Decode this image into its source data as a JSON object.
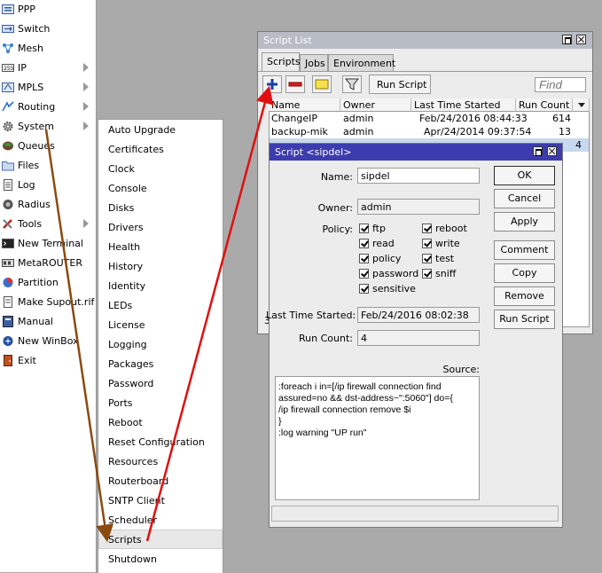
{
  "left_menu": {
    "items": [
      {
        "label": "PPP",
        "icon": "ppp-icon",
        "submenu": false
      },
      {
        "label": "Switch",
        "icon": "switch-icon",
        "submenu": false
      },
      {
        "label": "Mesh",
        "icon": "mesh-icon",
        "submenu": false
      },
      {
        "label": "IP",
        "icon": "ip-icon",
        "submenu": true
      },
      {
        "label": "MPLS",
        "icon": "mpls-icon",
        "submenu": true
      },
      {
        "label": "Routing",
        "icon": "routing-icon",
        "submenu": true
      },
      {
        "label": "System",
        "icon": "gear-icon",
        "submenu": true
      },
      {
        "label": "Queues",
        "icon": "queues-icon",
        "submenu": false
      },
      {
        "label": "Files",
        "icon": "folder-icon",
        "submenu": false
      },
      {
        "label": "Log",
        "icon": "log-icon",
        "submenu": false
      },
      {
        "label": "Radius",
        "icon": "radius-icon",
        "submenu": false
      },
      {
        "label": "Tools",
        "icon": "tools-icon",
        "submenu": true
      },
      {
        "label": "New Terminal",
        "icon": "terminal-icon",
        "submenu": false
      },
      {
        "label": "MetaROUTER",
        "icon": "metarouter-icon",
        "submenu": false
      },
      {
        "label": "Partition",
        "icon": "partition-icon",
        "submenu": false
      },
      {
        "label": "Make Supout.rif",
        "icon": "supout-icon",
        "submenu": false
      },
      {
        "label": "Manual",
        "icon": "manual-icon",
        "submenu": false
      },
      {
        "label": "New WinBox",
        "icon": "winbox-icon",
        "submenu": false
      },
      {
        "label": "Exit",
        "icon": "exit-icon",
        "submenu": false
      }
    ]
  },
  "system_submenu": {
    "items": [
      "Auto Upgrade",
      "Certificates",
      "Clock",
      "Console",
      "Disks",
      "Drivers",
      "Health",
      "History",
      "Identity",
      "LEDs",
      "License",
      "Logging",
      "Packages",
      "Password",
      "Ports",
      "Reboot",
      "Reset Configuration",
      "Resources",
      "Routerboard",
      "SNTP Client",
      "Scheduler",
      "Scripts",
      "Shutdown"
    ],
    "selected": "Scripts"
  },
  "script_list": {
    "title": "Script List",
    "tabs": [
      "Scripts",
      "Jobs",
      "Environment"
    ],
    "active_tab": "Scripts",
    "run_script_label": "Run Script",
    "find_placeholder": "Find",
    "columns": [
      "Name",
      "Owner",
      "Last Time Started",
      "Run Count"
    ],
    "rows": [
      {
        "name": "ChangeIP",
        "owner": "admin",
        "last": "Feb/24/2016 08:44:33",
        "count": "614"
      },
      {
        "name": "backup-mik",
        "owner": "admin",
        "last": "Apr/24/2014 09:37:54",
        "count": "13"
      },
      {
        "name": "",
        "owner": "",
        "last": "",
        "count": "4"
      }
    ],
    "footer_count": "3"
  },
  "script_dialog": {
    "title": "Script <sipdel>",
    "name_label": "Name:",
    "name_value": "sipdel",
    "owner_label": "Owner:",
    "owner_value": "admin",
    "policy_label": "Policy:",
    "policies": [
      {
        "label": "ftp",
        "checked": true
      },
      {
        "label": "reboot",
        "checked": true
      },
      {
        "label": "read",
        "checked": true
      },
      {
        "label": "write",
        "checked": true
      },
      {
        "label": "policy",
        "checked": true
      },
      {
        "label": "test",
        "checked": true
      },
      {
        "label": "password",
        "checked": true
      },
      {
        "label": "sniff",
        "checked": true
      },
      {
        "label": "sensitive",
        "checked": true
      }
    ],
    "last_started_label": "Last Time Started:",
    "last_started_value": "Feb/24/2016 08:02:38",
    "run_count_label": "Run Count:",
    "run_count_value": "4",
    "source_label": "Source:",
    "source_lines": [
      ":foreach i in=[/ip firewall connection find",
      "assured=no && dst-address~\":5060\"] do={",
      "/ip firewall connection remove $i",
      "}",
      ":log warning \"UP run\""
    ],
    "buttons": [
      "OK",
      "Cancel",
      "Apply",
      "Comment",
      "Copy",
      "Remove",
      "Run Script"
    ]
  },
  "colors": {
    "dialog_title": "#3c3cae",
    "list_title": "#b8bcc4",
    "arrow_red": "#e01010",
    "arrow_brown": "#8b4a10"
  }
}
